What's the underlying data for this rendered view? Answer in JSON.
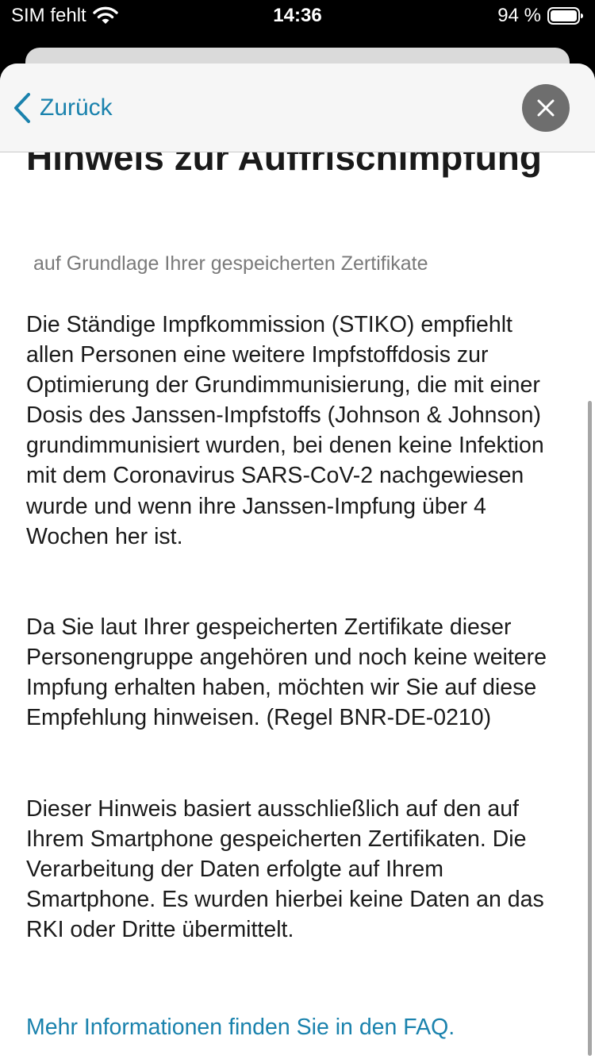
{
  "status_bar": {
    "carrier": "SIM fehlt",
    "time": "14:36",
    "battery": "94 %"
  },
  "nav": {
    "back_label": "Zurück"
  },
  "content": {
    "title": "Hinweis zur Auffrischimpfung",
    "subtitle": "auf Grundlage Ihrer gespeicherten Zertifikate",
    "paragraph_1": "Die Ständige Impfkommission (STIKO) empfiehlt allen Personen eine weitere Impfstoffdosis zur Optimierung der Grundimmunisierung, die mit einer Dosis des Janssen-Impfstoffs (Johnson & Johnson) grundimmunisiert wurden, bei denen keine Infektion mit dem Coronavirus SARS-CoV-2 nachgewiesen wurde und wenn ihre Janssen-Impfung über 4 Wochen her ist.",
    "paragraph_2": "Da Sie laut Ihrer gespeicherten Zertifikate dieser Personengruppe angehören und noch keine weitere Impfung erhalten haben, möchten wir Sie auf diese Empfehlung hinweisen. (Regel BNR-DE-0210)",
    "paragraph_3": "Dieser Hinweis basiert ausschließlich auf den auf Ihrem Smartphone gespeicherten Zertifikaten. Die Verarbeitung der Daten erfolgte auf Ihrem Smartphone. Es wurden hierbei keine Daten an das RKI oder Dritte übermittelt.",
    "faq_link": "Mehr Informationen finden Sie in den FAQ."
  },
  "colors": {
    "accent": "#1a82ad",
    "close_button": "#6e6e6e"
  },
  "icons": {
    "wifi": "wifi-icon",
    "battery": "battery-icon",
    "back": "chevron-left-icon",
    "close": "close-icon"
  }
}
